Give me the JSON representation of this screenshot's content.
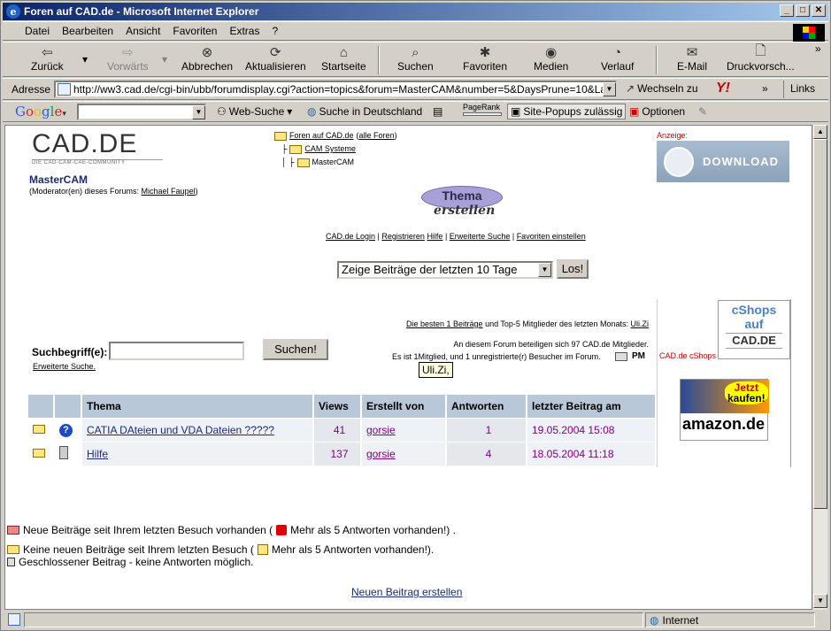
{
  "window": {
    "title": "Foren auf CAD.de - Microsoft Internet Explorer"
  },
  "menu": [
    "Datei",
    "Bearbeiten",
    "Ansicht",
    "Favoriten",
    "Extras",
    "?"
  ],
  "toolbar": {
    "back": "Zurück",
    "forward": "Vorwärts",
    "stop": "Abbrechen",
    "refresh": "Aktualisieren",
    "home": "Startseite",
    "search": "Suchen",
    "favorites": "Favoriten",
    "media": "Medien",
    "history": "Verlauf",
    "mail": "E-Mail",
    "print": "Druckvorsch..."
  },
  "address": {
    "label": "Adresse",
    "url": "http://ww3.cad.de/cgi-bin/ubb/forumdisplay.cgi?action=topics&forum=MasterCAM&number=5&DaysPrune=10&LastLogin=&my",
    "go": "Wechseln zu",
    "links": "Links"
  },
  "googlebar": {
    "web_search": "Web-Suche",
    "search_de": "Suche in Deutschland",
    "pagerank": "PageRank",
    "popups": "Site-Popups zulässig",
    "options": "Optionen"
  },
  "page": {
    "logo_text": "CAD.DE",
    "logo_tagline": "DIE CAD-CAM-CAE-COMMUNITY",
    "breadcrumb": {
      "root": "Foren auf CAD.de",
      "all": "alle Foren",
      "cat": "CAM Systeme",
      "forum": "MasterCAM"
    },
    "forum_name": "MasterCAM",
    "moderator_prefix": "(Moderator(en) dieses Forums: ",
    "moderator": "Michael Faupel",
    "moderator_suffix": ")",
    "new_topic_img": {
      "line1": "Thema",
      "line2": "erstellen"
    },
    "nav": [
      "CAD.de Login",
      "Registrieren",
      "Hilfe",
      "Erweiterte Suche",
      "Favoriten einstellen"
    ],
    "days_select": "Zeige Beiträge der letzten 10 Tage",
    "go_button": "Los!",
    "ad_label": "Anzeige:",
    "ad_download": "DOWNLOAD",
    "best_link": "Die besten 1 Beiträge",
    "best_rest": " und Top-5 Mitglieder des letzten Monats: ",
    "best_user": "Uli.Zi",
    "members_line": "An diesem Forum beteiligen sich 97 CAD.de Mitglieder.",
    "online_prefix": "Es ist 1",
    "online_rest": "Mitglied, und 1 unregistrierte(r) Besucher im Forum.",
    "pm_label": "PM",
    "tooltip": "Uli.Zi,",
    "search_label": "Suchbegriff(e):",
    "search_button": "Suchen!",
    "adv_search": "Erweiterte Suche.",
    "cshops": {
      "line1": "cShops",
      "line2": "auf",
      "line3": "CAD.DE",
      "label": "CAD.de cShops"
    },
    "amazon": {
      "jetzt": "Jetzt",
      "kaufen": "kaufen!",
      "brand": "amazon.de"
    },
    "table": {
      "headers": [
        "Thema",
        "Views",
        "Erstellt von",
        "Antworten",
        "letzter Beitrag am"
      ],
      "rows": [
        {
          "topic": "CATIA DAteien und VDA Dateien ?????",
          "views": "41",
          "author": "gorsie",
          "replies": "1",
          "date": "19.05.2004 15:08"
        },
        {
          "topic": "Hilfe",
          "views": "137",
          "author": "gorsie",
          "replies": "4",
          "date": "18.05.2004 11:18"
        }
      ]
    },
    "legend": {
      "new_a": "Neue Beiträge seit Ihrem letzten Besuch vorhanden (",
      "new_b": " Mehr als 5 Antworten vorhanden!) .",
      "old_a": "Keine neuen Beiträge seit Ihrem letzten Besuch (",
      "old_b": " Mehr als 5 Antworten vorhanden!).",
      "closed": "Geschlossener Beitrag - keine Antworten möglich."
    },
    "new_post_link": "Neuen Beitrag erstellen"
  },
  "status": {
    "zone": "Internet"
  }
}
